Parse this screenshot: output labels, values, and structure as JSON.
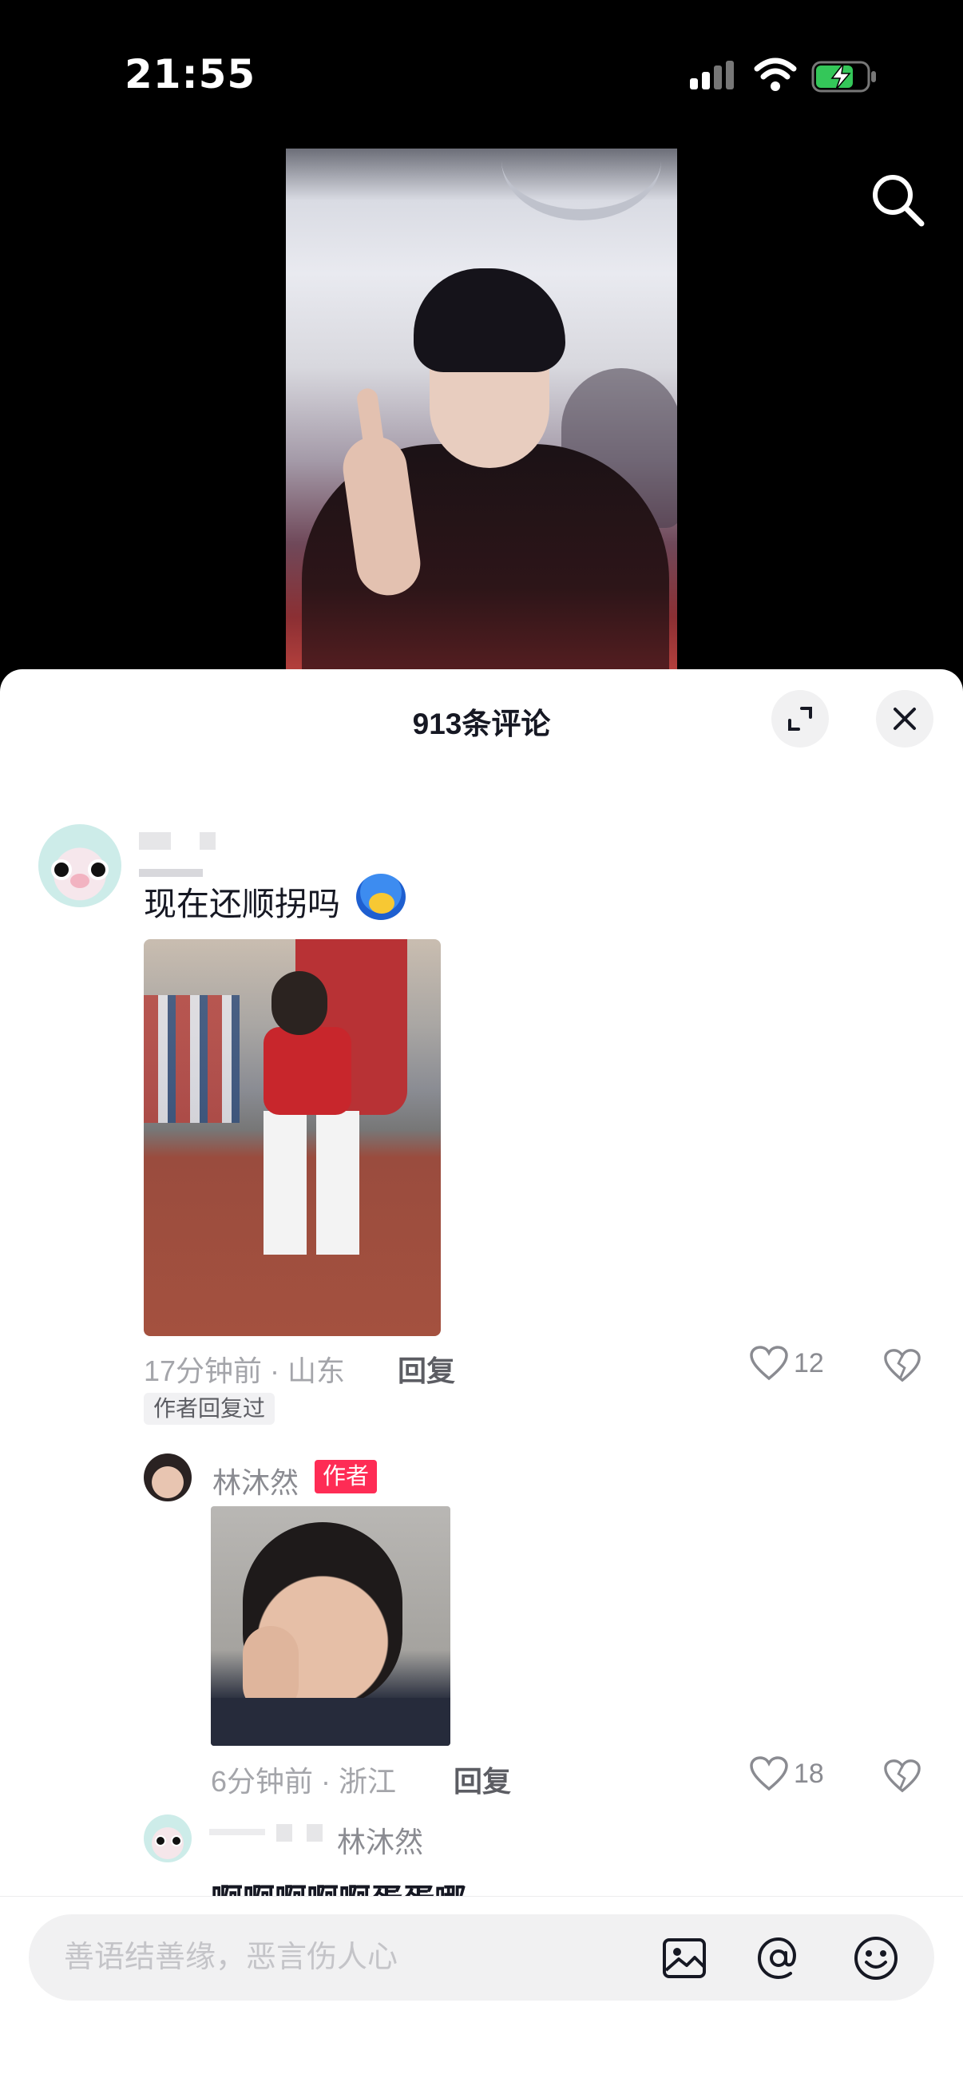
{
  "status_bar": {
    "time": "21:55",
    "signal_icon": "cellular-signal-icon",
    "wifi_icon": "wifi-icon",
    "battery_icon": "battery-charging-icon",
    "battery_color": "#34c759"
  },
  "top_bar": {
    "search_icon": "search-icon"
  },
  "comments_panel": {
    "title": "913条评论",
    "expand_icon": "expand-icon",
    "close_icon": "close-icon"
  },
  "comment": {
    "text": "现在还顺拐吗",
    "sticker_icon": "emoji-sticker-icon",
    "time_location": "17分钟前 · 山东",
    "reply_label": "回复",
    "likes": "12",
    "author_replied_tag": "作者回复过"
  },
  "author_reply": {
    "name": "林沐然",
    "badge": "作者",
    "time_location": "6分钟前 · 浙江",
    "reply_label": "回复",
    "likes": "18"
  },
  "sub_reply": {
    "reply_to": "林沐然",
    "text": "啊啊啊啊啊蛋蛋哪"
  },
  "input_bar": {
    "placeholder": "善语结善缘，恶言伤人心",
    "image_icon": "image-icon",
    "at_icon": "at-mention-icon",
    "emoji_icon": "emoji-icon"
  },
  "colors": {
    "accent_red": "#fe2c55",
    "text_primary": "#161823",
    "text_secondary": "#a4a5aa"
  }
}
